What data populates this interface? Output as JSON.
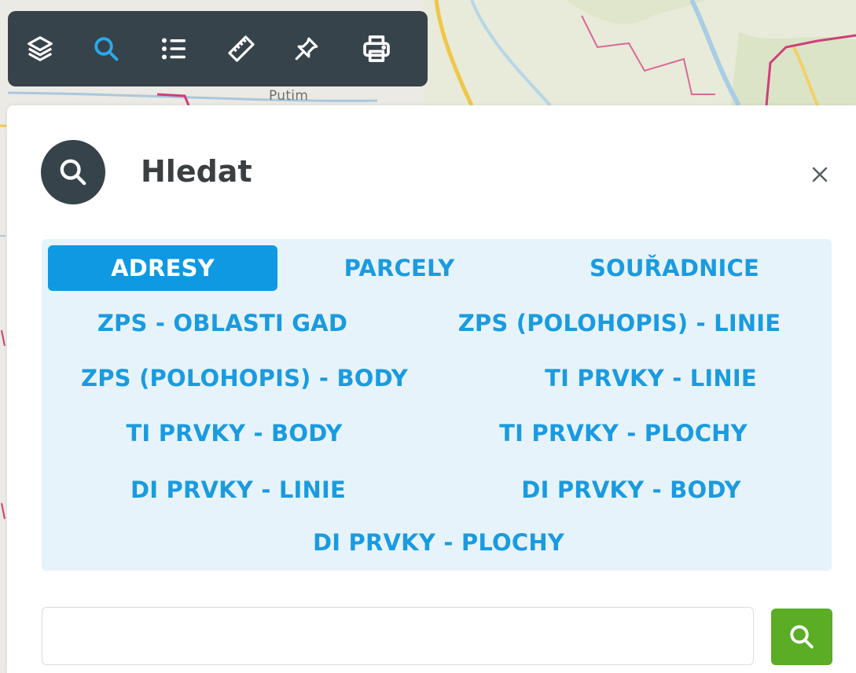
{
  "map": {
    "place_label": "Putim"
  },
  "toolbar": {
    "tools": [
      {
        "name": "layers-icon"
      },
      {
        "name": "search-icon"
      },
      {
        "name": "list-icon"
      },
      {
        "name": "ruler-icon"
      },
      {
        "name": "pin-icon"
      },
      {
        "name": "printer-icon"
      }
    ],
    "active_tool": "search-icon",
    "active_color": "#2aa9ec",
    "icon_color": "#ffffff"
  },
  "panel": {
    "title": "Hledat",
    "close_label": "×",
    "tabs": [
      {
        "label": "ADRESY",
        "active": true
      },
      {
        "label": "PARCELY",
        "active": false
      },
      {
        "label": "SOUŘADNICE",
        "active": false
      },
      {
        "label": "ZPS - OBLASTI GAD",
        "active": false
      },
      {
        "label": "ZPS (POLOHOPIS) - LINIE",
        "active": false
      },
      {
        "label": "ZPS (POLOHOPIS) - BODY",
        "active": false
      },
      {
        "label": "TI PRVKY - LINIE",
        "active": false
      },
      {
        "label": "TI PRVKY - BODY",
        "active": false
      },
      {
        "label": "TI PRVKY - PLOCHY",
        "active": false
      },
      {
        "label": "DI PRVKY - LINIE",
        "active": false
      },
      {
        "label": "DI PRVKY - BODY",
        "active": false
      },
      {
        "label": "DI PRVKY - PLOCHY",
        "active": false
      }
    ],
    "search": {
      "value": "",
      "placeholder": ""
    }
  },
  "colors": {
    "toolbar_bg": "#36434b",
    "tab_text": "#1a9be0",
    "tab_active_bg": "#0f99e3",
    "tabs_bg": "#e7f3fb",
    "search_button_bg": "#5aad24"
  }
}
